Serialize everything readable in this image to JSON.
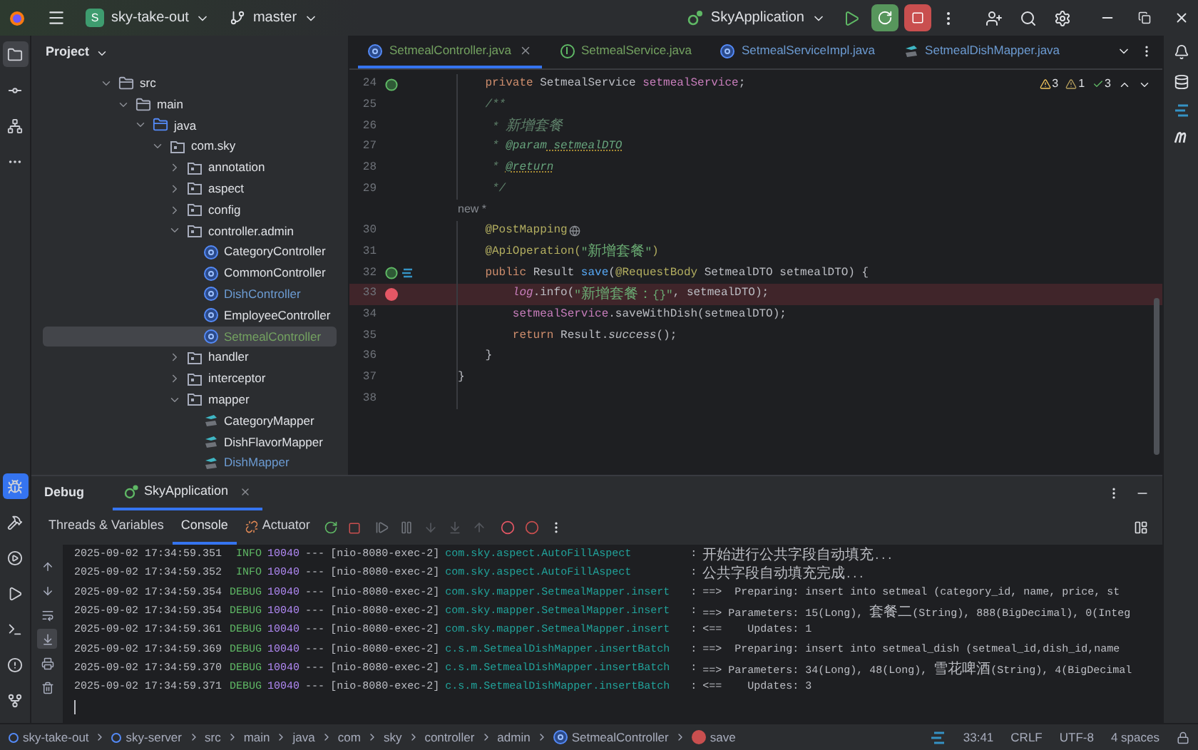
{
  "title_bar": {
    "project_badge": "S",
    "project": "sky-take-out",
    "branch": "master",
    "run_config": "SkyApplication"
  },
  "left_toolbar": {
    "top": [
      {
        "kind": "folder",
        "selected": true
      },
      {
        "kind": "commit",
        "selected": false
      },
      {
        "kind": "structure",
        "selected": false
      },
      {
        "kind": "more",
        "selected": false
      }
    ],
    "bottom": [
      {
        "kind": "debug",
        "selected": true
      },
      {
        "kind": "build",
        "selected": false
      },
      {
        "kind": "services",
        "selected": false
      },
      {
        "kind": "run",
        "selected": false
      },
      {
        "kind": "terminal",
        "selected": false
      },
      {
        "kind": "problems",
        "selected": false
      },
      {
        "kind": "git",
        "selected": false
      }
    ]
  },
  "project_panel": {
    "title": "Project",
    "tree": [
      {
        "label": "src",
        "kind": "folder",
        "expanded": true,
        "selected": false,
        "color": "#dfe1e5",
        "children": [
          {
            "label": "main",
            "kind": "folder",
            "expanded": true,
            "selected": false,
            "color": "#dfe1e5",
            "children": [
              {
                "label": "java",
                "kind": "source",
                "expanded": true,
                "selected": false,
                "color": "#dfe1e5",
                "children": [
                  {
                    "label": "com.sky",
                    "kind": "package",
                    "expanded": true,
                    "selected": false,
                    "color": "#dfe1e5",
                    "children": [
                      {
                        "label": "annotation",
                        "kind": "package",
                        "expanded": false,
                        "selected": false,
                        "color": "#dfe1e5"
                      },
                      {
                        "label": "aspect",
                        "kind": "package",
                        "expanded": false,
                        "selected": false,
                        "color": "#dfe1e5"
                      },
                      {
                        "label": "config",
                        "kind": "package",
                        "expanded": false,
                        "selected": false,
                        "color": "#dfe1e5"
                      },
                      {
                        "label": "controller.admin",
                        "kind": "package",
                        "expanded": true,
                        "selected": false,
                        "color": "#dfe1e5",
                        "children": [
                          {
                            "label": "CategoryController",
                            "kind": "class",
                            "selected": false,
                            "color": "#dfe1e5"
                          },
                          {
                            "label": "CommonController",
                            "kind": "class",
                            "selected": false,
                            "color": "#dfe1e5"
                          },
                          {
                            "label": "DishController",
                            "kind": "class",
                            "selected": false,
                            "color": "#6c9bd2"
                          },
                          {
                            "label": "EmployeeController",
                            "kind": "class",
                            "selected": false,
                            "color": "#dfe1e5"
                          },
                          {
                            "label": "SetmealController",
                            "kind": "class",
                            "selected": true,
                            "color": "#73a160"
                          }
                        ]
                      },
                      {
                        "label": "handler",
                        "kind": "package",
                        "expanded": false,
                        "selected": false,
                        "color": "#dfe1e5"
                      },
                      {
                        "label": "interceptor",
                        "kind": "package",
                        "expanded": false,
                        "selected": false,
                        "color": "#dfe1e5"
                      },
                      {
                        "label": "mapper",
                        "kind": "package",
                        "expanded": true,
                        "selected": false,
                        "color": "#dfe1e5",
                        "children": [
                          {
                            "label": "CategoryMapper",
                            "kind": "mapper",
                            "selected": false,
                            "color": "#dfe1e5"
                          },
                          {
                            "label": "DishFlavorMapper",
                            "kind": "mapper",
                            "selected": false,
                            "color": "#dfe1e5"
                          },
                          {
                            "label": "DishMapper",
                            "kind": "mapper",
                            "selected": false,
                            "color": "#6c9bd2"
                          }
                        ]
                      }
                    ]
                  }
                ]
              }
            ]
          }
        ]
      }
    ]
  },
  "editor_tabs": [
    {
      "label": "SetmealController.java",
      "kind": "class",
      "selected": true,
      "color": "#73a160"
    },
    {
      "label": "SetmealService.java",
      "kind": "interface",
      "selected": false,
      "color": "#73a160"
    },
    {
      "label": "SetmealServiceImpl.java",
      "kind": "class",
      "selected": false,
      "color": "#6c9bd2"
    },
    {
      "label": "SetmealDishMapper.java",
      "kind": "mapper",
      "selected": false,
      "color": "#6c9bd2"
    }
  ],
  "inspections": [
    {
      "kind": "warning",
      "count": "3"
    },
    {
      "kind": "weak",
      "count": "1"
    },
    {
      "kind": "ok",
      "count": "3"
    }
  ],
  "code_lines": [
    {
      "number": "24",
      "bean": true,
      "mapping": false,
      "breakpoint": false,
      "tokens": [
        {
          "kind": "keyword",
          "text": "    private"
        },
        {
          "kind": "plain",
          "text": " SetmealService "
        },
        {
          "kind": "field",
          "text": "setmealService"
        },
        {
          "kind": "plain",
          "text": ";"
        }
      ]
    },
    {
      "number": "25",
      "bean": false,
      "mapping": false,
      "breakpoint": false,
      "tokens": [
        {
          "kind": "comment",
          "text": "    /**"
        }
      ]
    },
    {
      "number": "26",
      "bean": false,
      "mapping": false,
      "breakpoint": false,
      "tokens": [
        {
          "kind": "comment",
          "text": "     * 新增套餐"
        }
      ]
    },
    {
      "number": "27",
      "bean": false,
      "mapping": false,
      "breakpoint": false,
      "tokens": [
        {
          "kind": "comment",
          "text": "     * "
        },
        {
          "kind": "doctag",
          "text": "@param"
        },
        {
          "kind": "docref",
          "text": " setmealDTO"
        }
      ]
    },
    {
      "number": "28",
      "bean": false,
      "mapping": false,
      "breakpoint": false,
      "tokens": [
        {
          "kind": "comment",
          "text": "     * "
        },
        {
          "kind": "docref",
          "text": "@return"
        }
      ]
    },
    {
      "number": "29",
      "bean": false,
      "mapping": false,
      "breakpoint": false,
      "tokens": [
        {
          "kind": "comment",
          "text": "     */"
        }
      ]
    },
    {
      "inlay": "new *"
    },
    {
      "number": "30",
      "bean": false,
      "mapping": false,
      "breakpoint": false,
      "globe": true,
      "tokens": [
        {
          "kind": "annotation",
          "text": "    @PostMapping"
        }
      ]
    },
    {
      "number": "31",
      "bean": false,
      "mapping": false,
      "breakpoint": false,
      "tokens": [
        {
          "kind": "annotation",
          "text": "    @ApiOperation("
        },
        {
          "kind": "string",
          "text": "\"新增套餐\""
        },
        {
          "kind": "annotation",
          "text": ")"
        }
      ]
    },
    {
      "number": "32",
      "bean": true,
      "mapping": true,
      "breakpoint": false,
      "tokens": [
        {
          "kind": "keyword",
          "text": "    public"
        },
        {
          "kind": "plain",
          "text": " Result "
        },
        {
          "kind": "method",
          "text": "save"
        },
        {
          "kind": "plain",
          "text": "("
        },
        {
          "kind": "annotation",
          "text": "@RequestBody"
        },
        {
          "kind": "plain",
          "text": " SetmealDTO setmealDTO) {"
        }
      ]
    },
    {
      "number": "33",
      "bean": false,
      "mapping": false,
      "breakpoint": true,
      "tokens": [
        {
          "kind": "static",
          "text": "        log"
        },
        {
          "kind": "plain",
          "text": ".info("
        },
        {
          "kind": "string",
          "text": "\"新增套餐：{}\""
        },
        {
          "kind": "plain",
          "text": ", setmealDTO);"
        }
      ]
    },
    {
      "number": "34",
      "bean": false,
      "mapping": false,
      "breakpoint": false,
      "tokens": [
        {
          "kind": "field",
          "text": "        setmealService"
        },
        {
          "kind": "plain",
          "text": ".saveWithDish(setmealDTO);"
        }
      ]
    },
    {
      "number": "35",
      "bean": false,
      "mapping": false,
      "breakpoint": false,
      "tokens": [
        {
          "kind": "keyword",
          "text": "        return"
        },
        {
          "kind": "plain",
          "text": " Result."
        },
        {
          "kind": "italic",
          "text": "success"
        },
        {
          "kind": "plain",
          "text": "();"
        }
      ]
    },
    {
      "number": "36",
      "bean": false,
      "mapping": false,
      "breakpoint": false,
      "tokens": [
        {
          "kind": "plain",
          "text": "    }"
        }
      ]
    },
    {
      "number": "37",
      "bean": false,
      "mapping": false,
      "breakpoint": false,
      "tokens": [
        {
          "kind": "plain",
          "text": "}"
        }
      ]
    },
    {
      "number": "38",
      "bean": false,
      "mapping": false,
      "breakpoint": false
    }
  ],
  "debug_panel": {
    "title": "Debug",
    "session": "SkyApplication",
    "tabs": [
      {
        "label": "Threads & Variables",
        "selected": false
      },
      {
        "label": "Console",
        "selected": true
      },
      {
        "label": "Actuator",
        "selected": false
      }
    ],
    "console_side": [
      {
        "kind": "up",
        "selected": false
      },
      {
        "kind": "down",
        "selected": false
      },
      {
        "kind": "wrap",
        "selected": false
      },
      {
        "kind": "scroll-end",
        "selected": true
      },
      {
        "kind": "print",
        "selected": false
      },
      {
        "kind": "trash",
        "selected": false
      }
    ],
    "log": [
      {
        "time": "2025-09-02 17:34:59.351",
        "level": "INFO",
        "pid": "10040",
        "sep": "---",
        "thread": "[nio-8080-exec-2]",
        "logger": "com.sky.aspect.AutoFillAspect",
        "colon": ":",
        "message": "开始进行公共字段自动填充..."
      },
      {
        "time": "2025-09-02 17:34:59.352",
        "level": "INFO",
        "pid": "10040",
        "sep": "---",
        "thread": "[nio-8080-exec-2]",
        "logger": "com.sky.aspect.AutoFillAspect",
        "colon": ":",
        "message": "公共字段自动填充完成..."
      },
      {
        "time": "2025-09-02 17:34:59.354",
        "level": "DEBUG",
        "pid": "10040",
        "sep": "---",
        "thread": "[nio-8080-exec-2]",
        "logger": "com.sky.mapper.SetmealMapper.insert",
        "colon": ":",
        "message": "==>  Preparing: insert into setmeal (category_id, name, price, st"
      },
      {
        "time": "2025-09-02 17:34:59.354",
        "level": "DEBUG",
        "pid": "10040",
        "sep": "---",
        "thread": "[nio-8080-exec-2]",
        "logger": "com.sky.mapper.SetmealMapper.insert",
        "colon": ":",
        "message": "==> Parameters: 15(Long), 套餐二(String), 888(BigDecimal), 0(Integ"
      },
      {
        "time": "2025-09-02 17:34:59.361",
        "level": "DEBUG",
        "pid": "10040",
        "sep": "---",
        "thread": "[nio-8080-exec-2]",
        "logger": "com.sky.mapper.SetmealMapper.insert",
        "colon": ":",
        "message": "<==    Updates: 1"
      },
      {
        "time": "2025-09-02 17:34:59.369",
        "level": "DEBUG",
        "pid": "10040",
        "sep": "---",
        "thread": "[nio-8080-exec-2]",
        "logger": "c.s.m.SetmealDishMapper.insertBatch",
        "colon": ":",
        "message": "==>  Preparing: insert into setmeal_dish (setmeal_id,dish_id,name"
      },
      {
        "time": "2025-09-02 17:34:59.370",
        "level": "DEBUG",
        "pid": "10040",
        "sep": "---",
        "thread": "[nio-8080-exec-2]",
        "logger": "c.s.m.SetmealDishMapper.insertBatch",
        "colon": ":",
        "message": "==> Parameters: 34(Long), 48(Long), 雪花啤酒(String), 4(BigDecimal"
      },
      {
        "time": "2025-09-02 17:34:59.371",
        "level": "DEBUG",
        "pid": "10040",
        "sep": "---",
        "thread": "[nio-8080-exec-2]",
        "logger": "c.s.m.SetmealDishMapper.insertBatch",
        "colon": ":",
        "message": "<==    Updates: 3"
      }
    ]
  },
  "status_bar": {
    "breadcrumbs": [
      {
        "label": "sky-take-out",
        "kind": "module"
      },
      {
        "label": "sky-server",
        "kind": "module"
      },
      {
        "label": "src",
        "kind": "folder"
      },
      {
        "label": "main",
        "kind": "folder"
      },
      {
        "label": "java",
        "kind": "folder"
      },
      {
        "label": "com",
        "kind": "folder"
      },
      {
        "label": "sky",
        "kind": "folder"
      },
      {
        "label": "controller",
        "kind": "folder"
      },
      {
        "label": "admin",
        "kind": "folder"
      },
      {
        "label": "SetmealController",
        "kind": "class"
      },
      {
        "label": "save",
        "kind": "method"
      }
    ],
    "position": "33:41",
    "line_ending": "CRLF",
    "encoding": "UTF-8",
    "indent": "4 spaces"
  }
}
